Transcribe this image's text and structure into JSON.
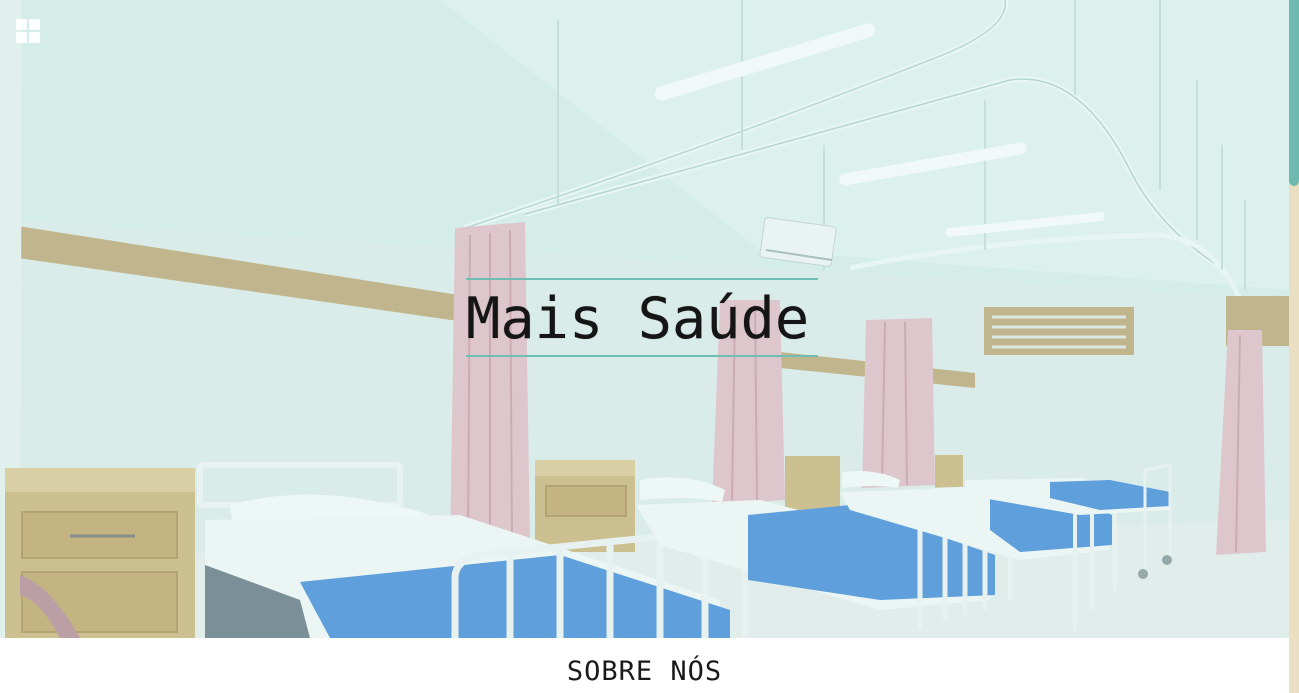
{
  "hero": {
    "title": "Mais Saúde",
    "image_alt": "hospital ward with beds",
    "menu_icon": "grid-menu-icon"
  },
  "about": {
    "title": "SOBRE NÓS"
  },
  "colors": {
    "accent": "#6fbdb3",
    "scrollbar_track": "#eadfc3",
    "scrollbar_thumb": "#6fbab0",
    "title_text": "#151515"
  }
}
